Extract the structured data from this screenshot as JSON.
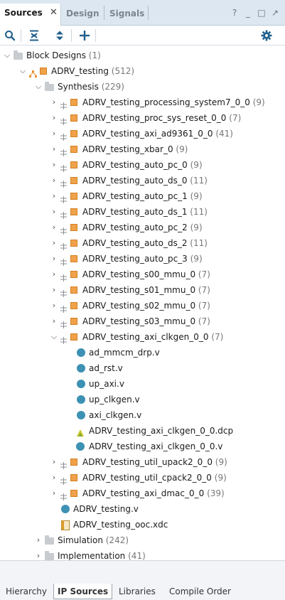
{
  "tabs": [
    {
      "label": "Sources",
      "active": true
    },
    {
      "label": "Design",
      "active": false
    },
    {
      "label": "Signals",
      "active": false
    }
  ],
  "window_controls": [
    "?",
    "_",
    "□",
    "↗"
  ],
  "toolbar": {
    "items": [
      "search-icon",
      "collapse-all-icon",
      "expand-all-icon",
      "add-icon",
      "gear-icon"
    ]
  },
  "tree": {
    "block_designs": {
      "label": "Block Designs",
      "count": "(1)"
    },
    "design": {
      "label": "ADRV_testing",
      "count": "(512)"
    },
    "synthesis": {
      "label": "Synthesis",
      "count": "(229)"
    },
    "ip_items": [
      {
        "label": "ADRV_testing_processing_system7_0_0",
        "count": "(9)"
      },
      {
        "label": "ADRV_testing_proc_sys_reset_0_0",
        "count": "(7)"
      },
      {
        "label": "ADRV_testing_axi_ad9361_0_0",
        "count": "(41)"
      },
      {
        "label": "ADRV_testing_xbar_0",
        "count": "(9)"
      },
      {
        "label": "ADRV_testing_auto_pc_0",
        "count": "(9)"
      },
      {
        "label": "ADRV_testing_auto_ds_0",
        "count": "(11)"
      },
      {
        "label": "ADRV_testing_auto_pc_1",
        "count": "(9)"
      },
      {
        "label": "ADRV_testing_auto_ds_1",
        "count": "(11)"
      },
      {
        "label": "ADRV_testing_auto_pc_2",
        "count": "(9)"
      },
      {
        "label": "ADRV_testing_auto_ds_2",
        "count": "(11)"
      },
      {
        "label": "ADRV_testing_auto_pc_3",
        "count": "(9)"
      },
      {
        "label": "ADRV_testing_s00_mmu_0",
        "count": "(7)"
      },
      {
        "label": "ADRV_testing_s01_mmu_0",
        "count": "(7)"
      },
      {
        "label": "ADRV_testing_s02_mmu_0",
        "count": "(7)"
      },
      {
        "label": "ADRV_testing_s03_mmu_0",
        "count": "(7)"
      },
      {
        "label": "ADRV_testing_axi_clkgen_0_0",
        "count": "(7)"
      }
    ],
    "clkgen_files": [
      {
        "label": "ad_mmcm_drp.v",
        "icon": "verilog-file-icon"
      },
      {
        "label": "ad_rst.v",
        "icon": "verilog-file-icon"
      },
      {
        "label": "up_axi.v",
        "icon": "verilog-file-icon"
      },
      {
        "label": "up_clkgen.v",
        "icon": "verilog-file-icon"
      },
      {
        "label": "axi_clkgen.v",
        "icon": "verilog-file-icon"
      },
      {
        "label": "ADRV_testing_axi_clkgen_0_0.dcp",
        "icon": "checkpoint-file-icon"
      },
      {
        "label": "ADRV_testing_axi_clkgen_0_0.v",
        "icon": "verilog-file-icon"
      }
    ],
    "ip_items_after": [
      {
        "label": "ADRV_testing_util_upack2_0_0",
        "count": "(9)"
      },
      {
        "label": "ADRV_testing_util_cpack2_0_0",
        "count": "(9)"
      },
      {
        "label": "ADRV_testing_axi_dmac_0_0",
        "count": "(39)"
      }
    ],
    "design_files": [
      {
        "label": "ADRV_testing.v",
        "icon": "verilog-file-icon"
      },
      {
        "label": "ADRV_testing_ooc.xdc",
        "icon": "constraints-file-icon"
      }
    ],
    "simulation": {
      "label": "Simulation",
      "count": "(242)"
    },
    "implementation": {
      "label": "Implementation",
      "count": "(41)"
    }
  },
  "bottom_tabs": [
    {
      "label": "Hierarchy",
      "active": false
    },
    {
      "label": "IP Sources",
      "active": true
    },
    {
      "label": "Libraries",
      "active": false
    },
    {
      "label": "Compile Order",
      "active": false
    }
  ],
  "colors": {
    "tab_bar_bg": "#dde7f1",
    "verilog_dot": "#3d91b3",
    "ip_core": "#f0a24a",
    "accent_icon": "#1f5f8c"
  }
}
